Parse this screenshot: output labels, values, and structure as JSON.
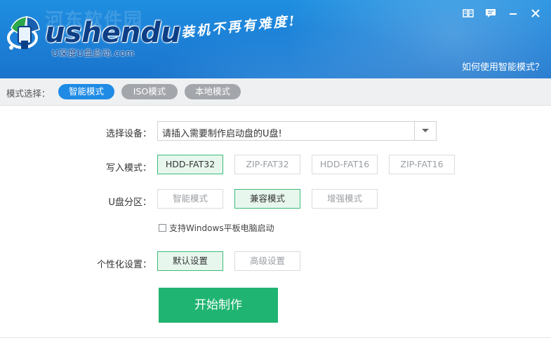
{
  "header": {
    "watermark": "河东软件园",
    "logo_name": "ushendu",
    "logo_sub": "U深度U盘启动.com",
    "slogan": "装机不再有难度!",
    "help_link": "如何使用智能模式？",
    "controls": [
      "book-icon",
      "message-icon",
      "minimize-icon",
      "close-icon"
    ]
  },
  "mode_bar": {
    "label": "模式选择：",
    "tabs": [
      {
        "label": "智能模式",
        "active": true
      },
      {
        "label": "ISO模式",
        "active": false
      },
      {
        "label": "本地模式",
        "active": false
      }
    ]
  },
  "form": {
    "device": {
      "label": "选择设备：",
      "value": "请插入需要制作启动盘的U盘!"
    },
    "write_mode": {
      "label": "写入模式：",
      "options": [
        "HDD-FAT32",
        "ZIP-FAT32",
        "HDD-FAT16",
        "ZIP-FAT16"
      ],
      "selected": "HDD-FAT32"
    },
    "partition": {
      "label": "U盘分区：",
      "options": [
        "智能模式",
        "兼容模式",
        "增强模式"
      ],
      "selected": "兼容模式"
    },
    "windows_tablet": {
      "label": "支持Windows平板电脑启动",
      "checked": false
    },
    "personalize": {
      "label": "个性化设置：",
      "options": [
        "默认设置",
        "高级设置"
      ],
      "selected": "默认设置"
    },
    "start_label": "开始制作"
  },
  "colors": {
    "header_blue": "#1c7fd6",
    "tab_active": "#1f8be5",
    "tab_inactive": "#a3a6aa",
    "selected_border": "#3dbb78",
    "start_green": "#1fb471"
  }
}
